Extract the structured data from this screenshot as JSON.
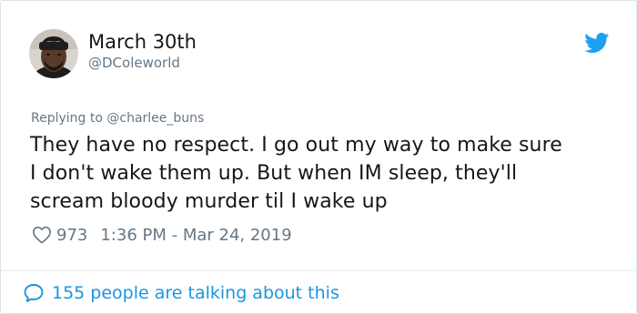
{
  "tweet": {
    "author_name": "March 30th",
    "author_handle": "@DColeworld",
    "replying_prefix": "Replying to ",
    "replying_to": "@charlee_buns",
    "text_lines": [
      "They have no respect. I go out my way to make sure",
      "I don't wake them up. But when IM sleep, they'll",
      "scream bloody murder til I wake up"
    ],
    "like_count": "973",
    "timestamp": "1:36 PM - Mar 24, 2019"
  },
  "footer": {
    "talking_label": "155 people are talking about this"
  },
  "icons": {
    "bird": "twitter-bird-icon",
    "heart": "heart-icon",
    "bubble": "speech-bubble-icon"
  },
  "colors": {
    "brand_blue": "#1DA1F2",
    "link_blue": "#1B95E0",
    "secondary_gray": "#657786",
    "text": "#14171A"
  }
}
